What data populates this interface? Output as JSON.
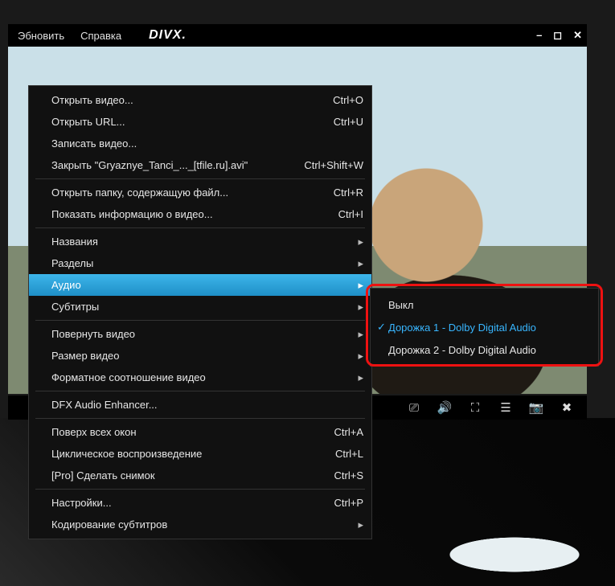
{
  "titlebar": {
    "menu_refresh": "Эбновить",
    "menu_help": "Справка",
    "logo": "DIVX."
  },
  "winctrl": {
    "min": "–",
    "max": "◻",
    "close": "✕"
  },
  "ctx": {
    "open_video": "Открыть видео...",
    "open_video_hk": "Ctrl+O",
    "open_url": "Открыть URL...",
    "open_url_hk": "Ctrl+U",
    "record_video": "Записать видео...",
    "close_file": "Закрыть \"Gryaznye_Tanci_..._[tfile.ru].avi\"",
    "close_file_hk": "Ctrl+Shift+W",
    "open_folder": "Открыть папку, содержащую файл...",
    "open_folder_hk": "Ctrl+R",
    "show_info": "Показать информацию о видео...",
    "show_info_hk": "Ctrl+I",
    "titles": "Названия",
    "chapters": "Разделы",
    "audio": "Аудио",
    "subtitles": "Субтитры",
    "rotate": "Повернуть видео",
    "video_size": "Размер видео",
    "aspect": "Форматное соотношение видео",
    "dfx": "DFX Audio Enhancer...",
    "ontop": "Поверх всех окон",
    "ontop_hk": "Ctrl+A",
    "loop": "Циклическое воспроизведение",
    "loop_hk": "Ctrl+L",
    "snapshot": "[Pro] Сделать снимок",
    "snapshot_hk": "Ctrl+S",
    "settings": "Настройки...",
    "settings_hk": "Ctrl+P",
    "sub_encoding": "Кодирование субтитров",
    "arrow": "▸"
  },
  "sub": {
    "off": "Выкл",
    "track1": "Дорожка 1 - Dolby Digital Audio",
    "track2": "Дорожка 2 - Dolby Digital Audio",
    "check": "✓"
  },
  "tb": {
    "cc": "⎚",
    "vol": "🔊",
    "fs": "⛶",
    "list": "☰",
    "cam": "📷",
    "x": "✖"
  }
}
